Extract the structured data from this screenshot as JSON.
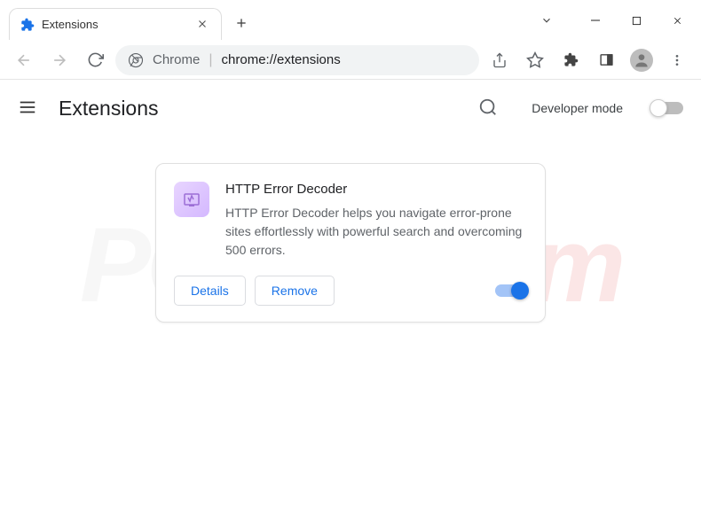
{
  "tab": {
    "title": "Extensions"
  },
  "omnibox": {
    "prefix": "Chrome",
    "url": "chrome://extensions"
  },
  "page": {
    "title": "Extensions",
    "dev_mode_label": "Developer mode"
  },
  "extension": {
    "name": "HTTP Error Decoder",
    "description": "HTTP Error Decoder helps you navigate error-prone sites effortlessly with powerful search and overcoming 500 errors.",
    "details_label": "Details",
    "remove_label": "Remove",
    "enabled": true
  }
}
